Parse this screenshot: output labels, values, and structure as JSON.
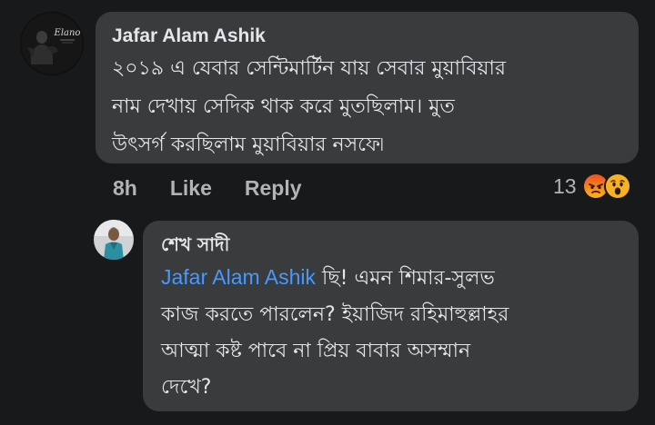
{
  "comment": {
    "author": "Jafar Alam Ashik",
    "avatar_text": "Elano",
    "lines": [
      "২০১৯ এ যেবার সেন্টিমার্টিন যায় সেবার মুয়াবিয়ার",
      "নাম দেখায় সেদিক থাক করে মুতছিলাম। মুত",
      "উৎসর্গ করছিলাম মুয়াবিয়ার নসফে৷"
    ],
    "time": "8h",
    "like_label": "Like",
    "reply_label": "Reply",
    "reaction_count": "13",
    "reaction_icons": [
      "angry-icon",
      "wow-icon"
    ],
    "colors": {
      "angry": "#e9710f",
      "wow": "#f7b125"
    }
  },
  "reply": {
    "author": "শেখ সাদী",
    "mention": "Jafar Alam Ashik",
    "first_line_rest": " ছি! এমন শিমার-সুলভ",
    "lines": [
      "কাজ করতে পারলেন? ইয়াজিদ রহিমাহুল্লাহর",
      "আত্মা কষ্ট পাবে না প্রিয় বাবার অসম্মান",
      "দেখে?"
    ]
  }
}
